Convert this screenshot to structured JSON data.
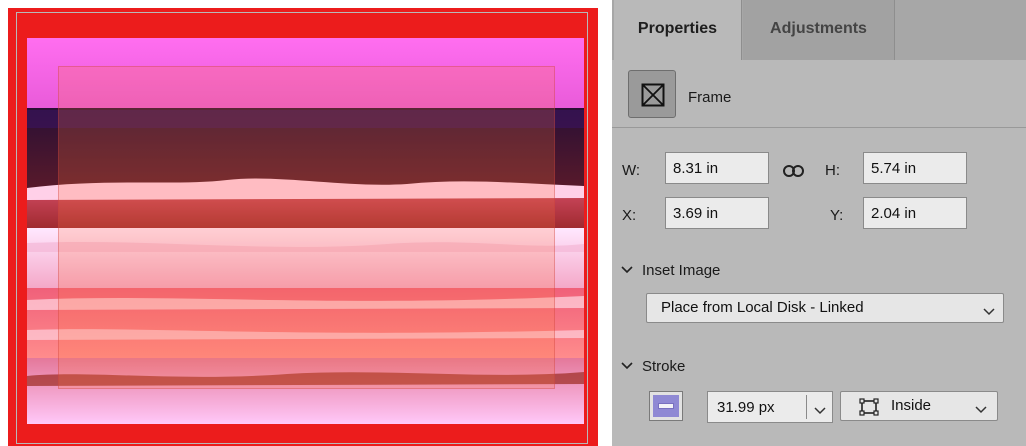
{
  "canvas": {
    "frame_color": "#ec1c1c"
  },
  "panel": {
    "tabs": [
      {
        "label": "Properties",
        "active": true
      },
      {
        "label": "Adjustments",
        "active": false
      }
    ],
    "layer_type": {
      "icon": "frame-icon",
      "label": "Frame"
    },
    "transform": {
      "w_label": "W:",
      "w_value": "8.31 in",
      "h_label": "H:",
      "h_value": "5.74 in",
      "x_label": "X:",
      "x_value": "3.69 in",
      "y_label": "Y:",
      "y_value": "2.04 in",
      "link_icon": "link-icon"
    },
    "inset_image": {
      "title": "Inset Image",
      "selected": "Place from Local Disk - Linked"
    },
    "stroke": {
      "title": "Stroke",
      "swatch_color": "#8f89d4",
      "width": "31.99 px",
      "position": "Inside"
    }
  }
}
